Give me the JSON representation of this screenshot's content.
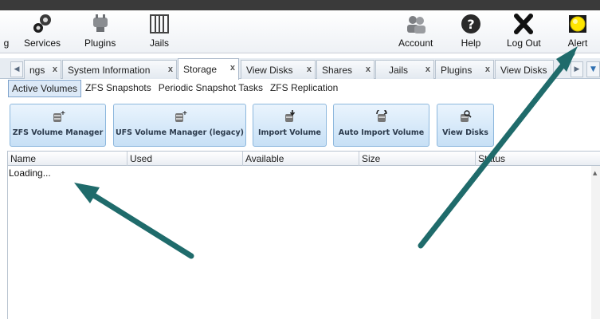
{
  "toolbar": {
    "items": [
      {
        "label": "g",
        "icon": "settings-icon"
      },
      {
        "label": "Services",
        "icon": "services-icon"
      },
      {
        "label": "Plugins",
        "icon": "plugins-icon"
      },
      {
        "label": "Jails",
        "icon": "jails-icon"
      },
      {
        "label": "Account",
        "icon": "account-icon"
      },
      {
        "label": "Help",
        "icon": "help-icon"
      },
      {
        "label": "Log Out",
        "icon": "logout-icon"
      },
      {
        "label": "Alert",
        "icon": "alert-icon"
      }
    ]
  },
  "tabs": [
    {
      "label": "ngs",
      "closable": true
    },
    {
      "label": "System Information",
      "closable": true
    },
    {
      "label": "Storage",
      "closable": true,
      "active": true
    },
    {
      "label": "View Disks",
      "closable": true
    },
    {
      "label": "Shares",
      "closable": true
    },
    {
      "label": "Jails",
      "closable": true
    },
    {
      "label": "Plugins",
      "closable": true
    },
    {
      "label": "View Disks",
      "closable": false
    }
  ],
  "tab_close_glyph": "x",
  "subnav": [
    "Active Volumes",
    "ZFS Snapshots",
    "Periodic Snapshot Tasks",
    "ZFS Replication"
  ],
  "buttons": [
    {
      "label": "ZFS Volume Manager",
      "icon": "volume-add-icon"
    },
    {
      "label": "UFS Volume Manager (legacy)",
      "icon": "volume-add-icon"
    },
    {
      "label": "Import Volume",
      "icon": "import-icon"
    },
    {
      "label": "Auto Import Volume",
      "icon": "auto-import-icon"
    },
    {
      "label": "View Disks",
      "icon": "view-disks-icon"
    }
  ],
  "grid": {
    "columns": [
      "Name",
      "Used",
      "Available",
      "Size",
      "Status"
    ],
    "loading_text": "Loading..."
  },
  "colors": {
    "accent": "#1f6b6b",
    "alert": "#ffe600",
    "button_top": "#eaf4fd",
    "button_bottom": "#c7e0f6"
  }
}
